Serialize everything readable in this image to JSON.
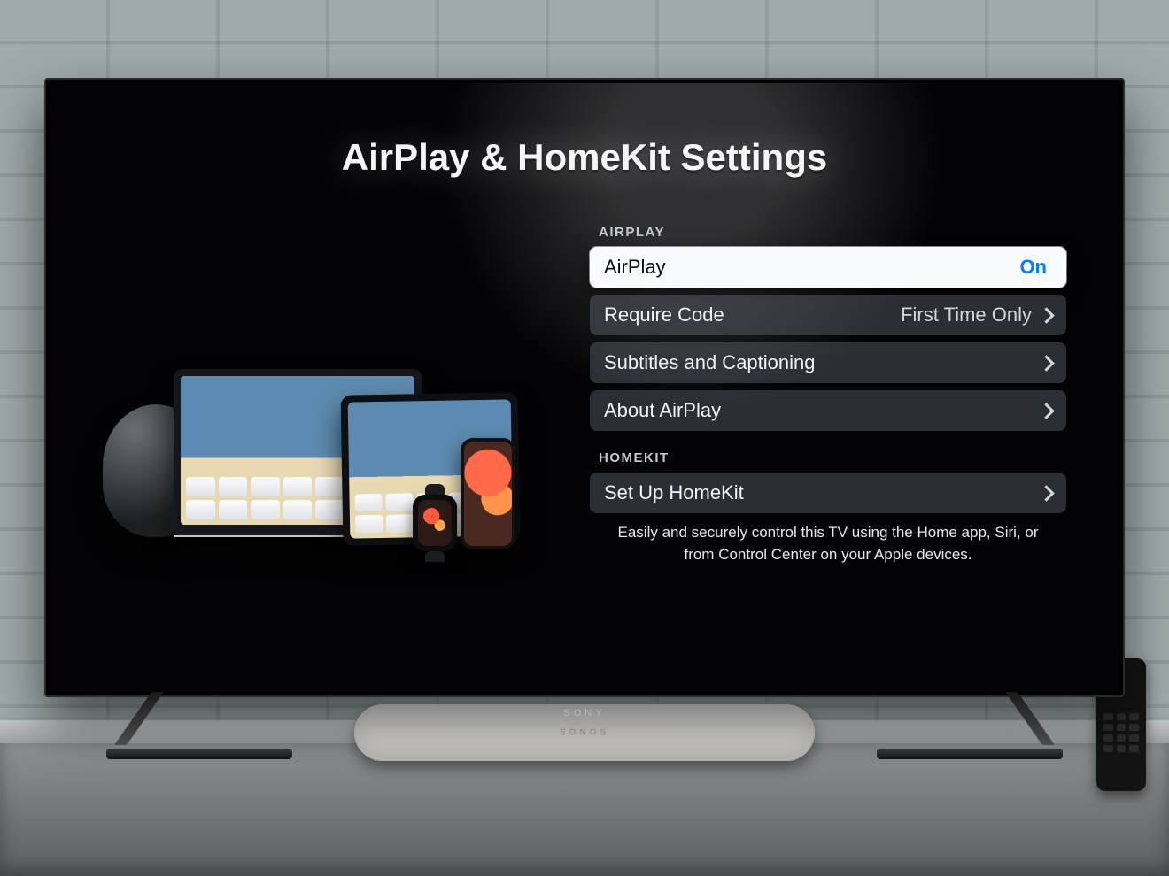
{
  "title": "AirPlay & HomeKit Settings",
  "tv_brand": "SONY",
  "sections": {
    "airplay": {
      "header": "AIRPLAY",
      "rows": {
        "toggle": {
          "label": "AirPlay",
          "value": "On"
        },
        "require": {
          "label": "Require Code",
          "value": "First Time Only"
        },
        "subtitles": {
          "label": "Subtitles and Captioning",
          "value": ""
        },
        "about": {
          "label": "About AirPlay",
          "value": ""
        }
      }
    },
    "homekit": {
      "header": "HOMEKIT",
      "rows": {
        "setup": {
          "label": "Set Up HomeKit",
          "value": ""
        }
      },
      "footnote": "Easily and securely control this TV using the Home app, Siri, or from Control Center on your Apple devices."
    }
  }
}
